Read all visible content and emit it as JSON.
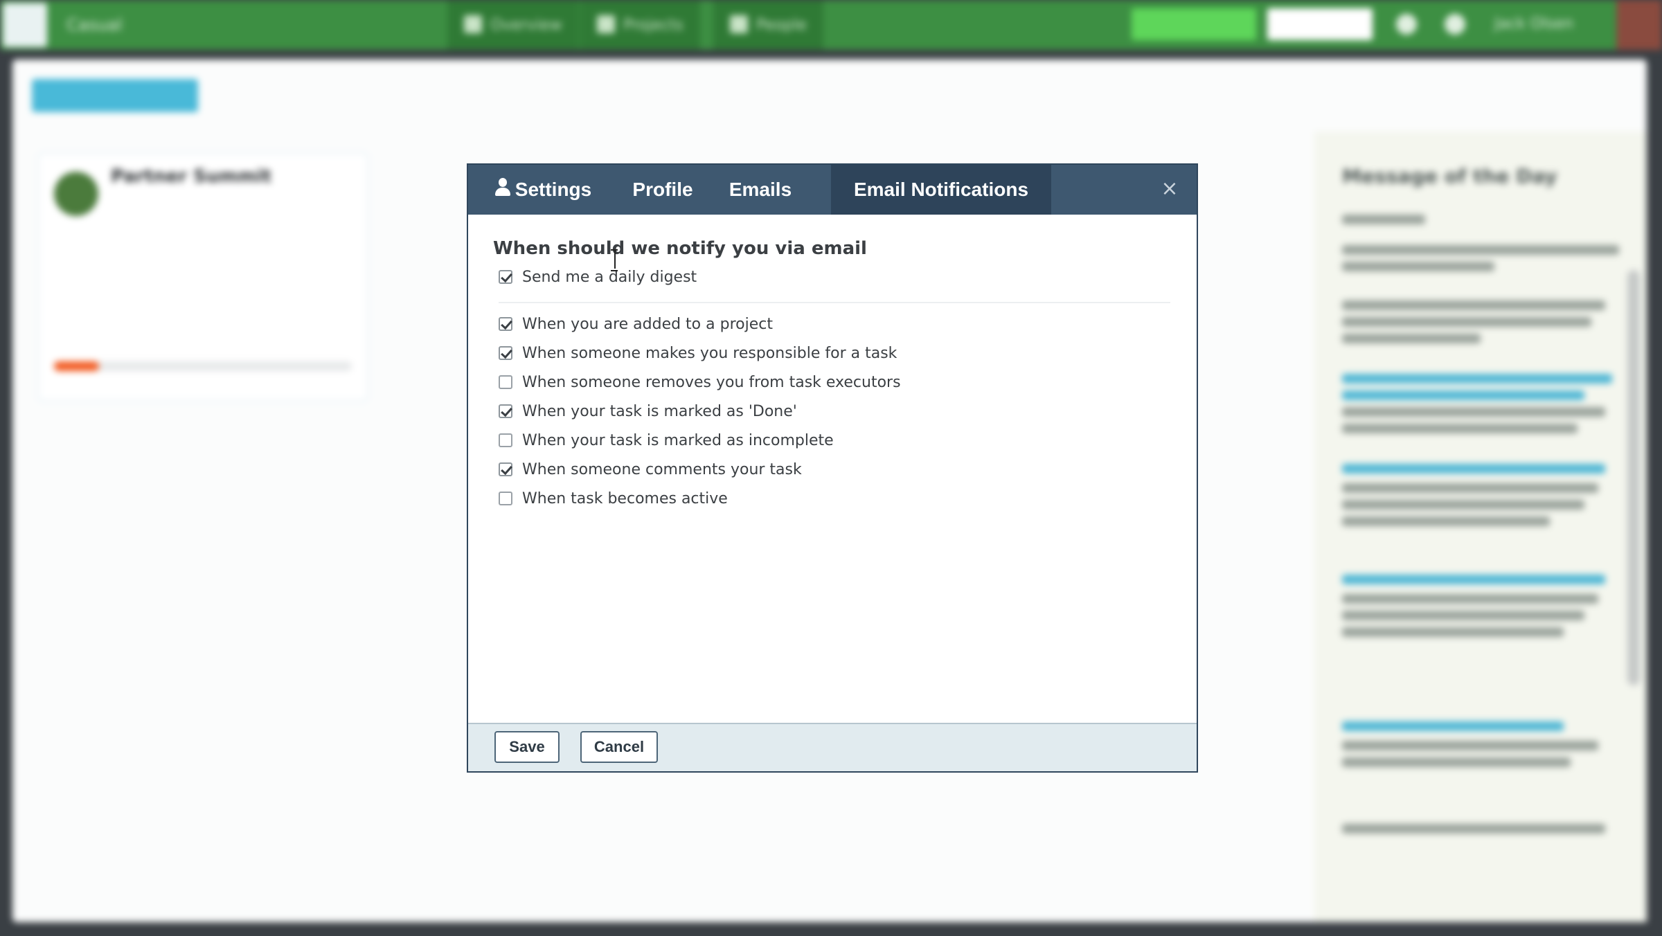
{
  "topbar": {
    "breadcrumb": "Casual",
    "nav": [
      {
        "label": "Overview"
      },
      {
        "label": "Projects"
      },
      {
        "label": "People"
      }
    ],
    "user_name": "Jack Olsen"
  },
  "workspace": {
    "card": {
      "title": "Partner Summit",
      "progress_fraction": 0.15
    },
    "side_panel": {
      "title": "Message of the Day"
    }
  },
  "modal": {
    "tabs": [
      {
        "label": "Settings",
        "icon": "user-icon",
        "active": false
      },
      {
        "label": "Profile",
        "active": false
      },
      {
        "label": "Emails",
        "active": false
      },
      {
        "label": "Email Notifications",
        "active": true
      }
    ],
    "close_label": "×",
    "heading": "When should we notify you via email",
    "digest": {
      "label": "Send me a daily digest",
      "checked": true
    },
    "options": [
      {
        "label": "When you are added to a project",
        "checked": true
      },
      {
        "label": "When someone makes you responsible for a task",
        "checked": true
      },
      {
        "label": "When someone removes you from task executors",
        "checked": false
      },
      {
        "label": "When your task is marked as 'Done'",
        "checked": true
      },
      {
        "label": "When your task is marked as incomplete",
        "checked": false
      },
      {
        "label": "When someone comments your task",
        "checked": true
      },
      {
        "label": "When task becomes active",
        "checked": false
      }
    ],
    "footer": {
      "save_label": "Save",
      "cancel_label": "Cancel"
    }
  },
  "colors": {
    "topbar_green": "#3d8f43",
    "modal_header": "#3e5870",
    "modal_tab_active": "#2e445a",
    "footer_bg": "#e1ebef"
  }
}
